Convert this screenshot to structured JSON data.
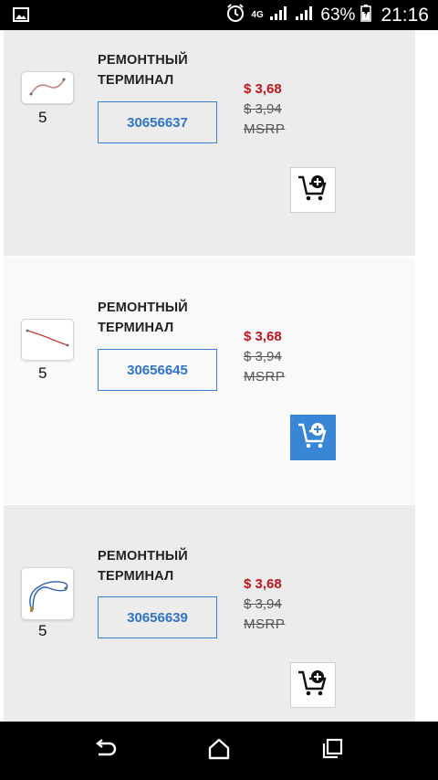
{
  "status_bar": {
    "network": "4G",
    "battery": "63%",
    "time": "21:16"
  },
  "products": [
    {
      "title": "РЕМОНТНЫЙ ТЕРМИНАЛ",
      "quantity": "5",
      "part_number": "30656637",
      "price": "$ 3,68",
      "old_price": "$ 3,94",
      "msrp": "MSRP",
      "thumb_icon": "wire-terminal-image",
      "cart_icon": "add-to-cart-icon"
    },
    {
      "title": "РЕМОНТНЫЙ ТЕРМИНАЛ",
      "quantity": "5",
      "part_number": "30656645",
      "price": "$ 3,68",
      "old_price": "$ 3,94",
      "msrp": "MSRP",
      "thumb_icon": "wire-terminal-image",
      "cart_icon": "add-to-cart-icon"
    },
    {
      "title": "РЕМОНТНЫЙ ТЕРМИНАЛ",
      "quantity": "5",
      "part_number": "30656639",
      "price": "$ 3,68",
      "old_price": "$ 3,94",
      "msrp": "MSRP",
      "thumb_icon": "wire-terminal-image",
      "cart_icon": "add-to-cart-icon"
    }
  ],
  "colors": {
    "accent_blue": "#3a86d6",
    "price_red": "#c0141e",
    "card_gray": "#ececec"
  },
  "nav_bar": {
    "back_icon": "back-icon",
    "home_icon": "home-icon",
    "recents_icon": "recents-icon"
  }
}
